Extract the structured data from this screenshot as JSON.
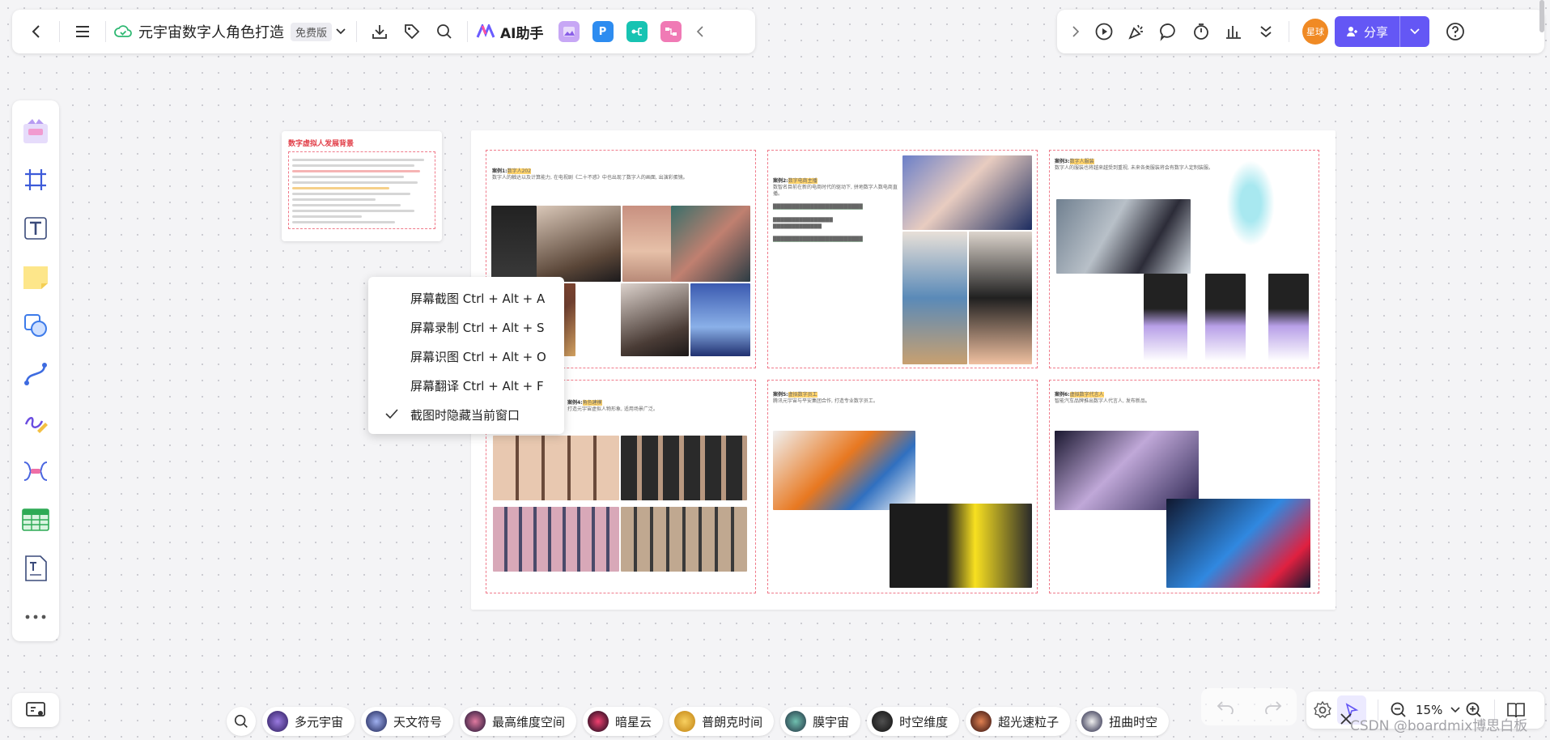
{
  "topbar": {
    "doc_title": "元宇宙数字人角色打造",
    "plan_badge": "免费版",
    "ai_label": "AI助手",
    "app_icon_p": "P"
  },
  "topbar_right": {
    "avatar_text": "星球",
    "share_label": "分享"
  },
  "left_tools": [
    "templates-icon",
    "frame-icon",
    "text-icon",
    "sticky-note-icon",
    "shape-icon",
    "connector-icon",
    "pen-icon",
    "mindmap-icon",
    "table-icon",
    "text-doc-icon",
    "more-icon"
  ],
  "thumb_card": {
    "title": "数字虚拟人发展背景"
  },
  "board": {
    "card1": {
      "case": "案例1:",
      "name": "数字人202",
      "desc": "数字人的触达以及计算能力, 在电视剧《二十不惑》中也出现了数字人的画面, 出演彩蛋镜。"
    },
    "card2": {
      "case": "案例2:",
      "name": "数字电商主播",
      "desc": "数智名目前在新的电商时代的驱动下, 拼地数字人数电商直播。"
    },
    "card3": {
      "case": "案例3:",
      "name": "数字人服装",
      "desc": "数字人的服装也将越来越受到重视, 未来各类服装将会有数字人定制装服。"
    },
    "card4": {
      "case": "案例4:",
      "name": "角色建模",
      "desc": "打造元宇宙虚拟人物形象, 适用场景广泛。"
    },
    "card5": {
      "case": "案例5:",
      "name": "虚拟数字员工",
      "desc": "腾讯元宇宙与平安集团合作, 打造专业数字员工。"
    },
    "card6": {
      "case": "案例6:",
      "name": "虚拟数字代言人",
      "desc": "智能汽车品牌推出数字人代言人, 发布新品。"
    }
  },
  "context_menu": {
    "items": [
      "屏幕截图 Ctrl + Alt + A",
      "屏幕录制 Ctrl + Alt + S",
      "屏幕识图 Ctrl + Alt + O",
      "屏幕翻译 Ctrl + Alt + F",
      "截图时隐藏当前窗口"
    ],
    "checked_index": 4
  },
  "bottom_bar": {
    "chips": [
      "多元宇宙",
      "天文符号",
      "最高维度空间",
      "暗星云",
      "普朗克时间",
      "膜宇宙",
      "时空维度",
      "超光速粒子",
      "扭曲时空"
    ]
  },
  "zoom": {
    "value": "15%"
  },
  "watermark": "CSDN @boardmix博思白板",
  "colors": {
    "accent": "#6457f5",
    "avatar": "#f08a24",
    "card_border": "#f07a8a"
  }
}
